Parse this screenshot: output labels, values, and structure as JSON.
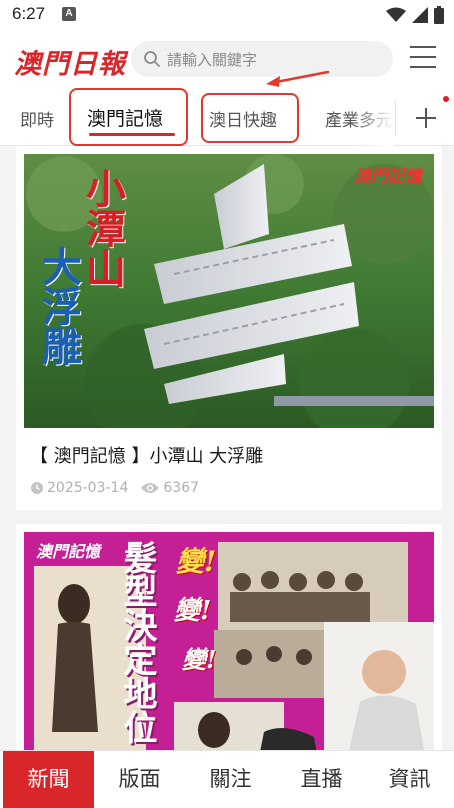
{
  "status_bar": {
    "time": "6:27",
    "badge": "A"
  },
  "header": {
    "logo_text": "澳門日報",
    "search_placeholder": "請輸入關鍵字"
  },
  "tabs": [
    {
      "label": "即時",
      "active": false
    },
    {
      "label": "澳門記憶",
      "active": true
    },
    {
      "label": "澳日快趣",
      "active": false
    },
    {
      "label": "產業多元",
      "active": false
    }
  ],
  "feed": {
    "articles": [
      {
        "title": "【 澳門記憶 】小潭山 大浮雕",
        "date": "2025-03-14",
        "views": "6367",
        "image": {
          "logo": "澳門記憶",
          "headline_top": "小潭山",
          "headline_bottom": "大浮雕"
        }
      },
      {
        "image": {
          "logo": "澳門記憶",
          "headline": "髮型決定地位",
          "exclaim1": "變!",
          "exclaim2": "變!",
          "exclaim3": "變!"
        }
      }
    ]
  },
  "bottom_nav": [
    {
      "label": "新聞",
      "active": true
    },
    {
      "label": "版面",
      "active": false
    },
    {
      "label": "關注",
      "active": false
    },
    {
      "label": "直播",
      "active": false
    },
    {
      "label": "資訊",
      "active": false
    }
  ],
  "colors": {
    "brand_red": "#d9262b",
    "annotation_red": "#e0392d"
  }
}
